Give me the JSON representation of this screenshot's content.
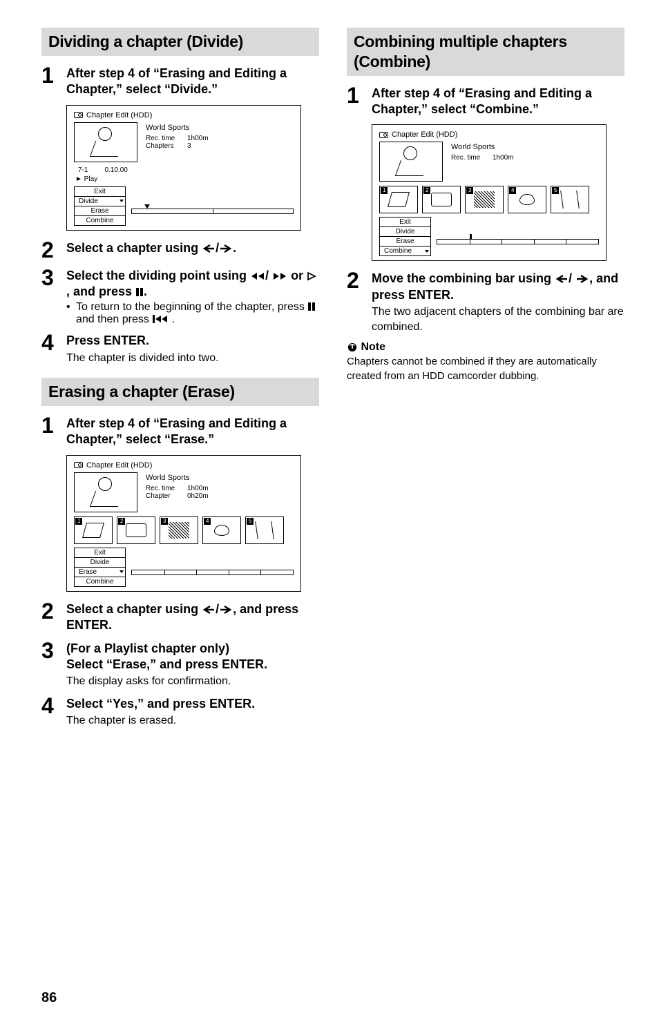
{
  "left": {
    "divide": {
      "header": "Dividing a chapter (Divide)",
      "step1": "After step 4 of “Erasing and Editing a Chapter,” select “Divide.”",
      "step2": "Select a chapter using ←/→.",
      "step3": "Select the dividing point using ◄◄/►► or ▷, and press ❙❙.",
      "step3_bullet": "To return to the beginning of the chapter, press ❙❙ and then press ❙◄◄ .",
      "step4_title": "Press ENTER.",
      "step4_sub": "The chapter is divided into two.",
      "ss": {
        "title": "Chapter Edit (HDD)",
        "meta_title": "World Sports",
        "rec_label": "Rec. time",
        "rec_val": "1h00m",
        "ch_label": "Chapters",
        "ch_val": "3",
        "pos_a": "7-1",
        "pos_b": "0.10.00",
        "play": "► Play",
        "m_exit": "Exit",
        "m_divide": "Divide",
        "m_erase": "Erase",
        "m_combine": "Combine"
      }
    },
    "erase": {
      "header": "Erasing a chapter (Erase)",
      "step1": "After step 4 of “Erasing and Editing a Chapter,” select “Erase.”",
      "step2": "Select a chapter using ←/→, and press ENTER.",
      "step3_title": "(For a Playlist chapter only)\nSelect “Erase,” and press ENTER.",
      "step3_sub": "The display asks for confirmation.",
      "step4_title": "Select “Yes,” and press ENTER.",
      "step4_sub": "The chapter is erased.",
      "ss": {
        "title": "Chapter Edit (HDD)",
        "meta_title": "World Sports",
        "rec_label": "Rec. time",
        "rec_val": "1h00m",
        "ch_label": "Chapter",
        "ch_val": "0h20m",
        "m_exit": "Exit",
        "m_divide": "Divide",
        "m_erase": "Erase",
        "m_combine": "Combine"
      }
    }
  },
  "right": {
    "combine": {
      "header": "Combining multiple chapters (Combine)",
      "step1": "After step 4 of “Erasing and Editing a Chapter,” select “Combine.”",
      "step2_title": "Move the combining bar using ←/→, and press ENTER.",
      "step2_sub": "The two adjacent chapters of the combining bar are combined.",
      "note_head": "Note",
      "note_body": "Chapters cannot be combined if they are automatically created from an HDD camcorder dubbing.",
      "ss": {
        "title": "Chapter Edit (HDD)",
        "meta_title": "World Sports",
        "rec_label": "Rec. time",
        "rec_val": "1h00m",
        "m_exit": "Exit",
        "m_divide": "Divide",
        "m_erase": "Erase",
        "m_combine": "Combine"
      }
    }
  },
  "page": "86",
  "thumbs": [
    "1",
    "2",
    "3",
    "4",
    "5"
  ]
}
